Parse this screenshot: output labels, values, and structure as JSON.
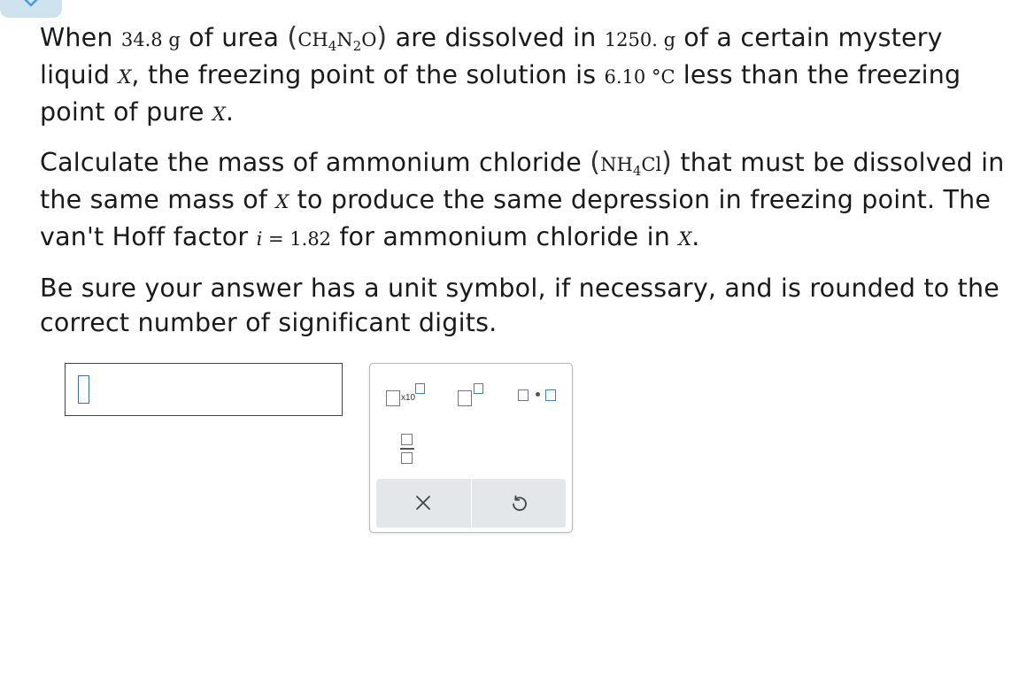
{
  "question": {
    "p1": {
      "t1": "When ",
      "urea_mass": "34.8",
      "urea_mass_unit": "g",
      "t2": " of urea ",
      "urea_formula": {
        "a": "CH",
        "s1": "4",
        "b": "N",
        "s2": "2",
        "c": "O"
      },
      "t3": " are dissolved in ",
      "liquid_mass": "1250.",
      "liquid_mass_unit": "g",
      "t4": " of a certain mystery liquid ",
      "liquid_symbol_1": "X",
      "t5": ", the freezing point of the solution is ",
      "dt_value": "6.10",
      "dt_unit": "°C",
      "t6": " less than the freezing point of pure ",
      "liquid_symbol_2": "X",
      "t7": "."
    },
    "p2": {
      "t1": "Calculate the mass of ammonium chloride ",
      "nh4cl_formula": {
        "a": "NH",
        "s1": "4",
        "b": "Cl"
      },
      "t2": " that must be dissolved in the same mass of ",
      "liquid_symbol_3": "X",
      "t3": " to produce the same depression in freezing point. The van't Hoff factor ",
      "i_symbol": "i",
      "i_equals": " = 1.82",
      "t4": " for ammonium chloride in ",
      "liquid_symbol_4": "X",
      "t5": "."
    },
    "p3": {
      "text": "Be sure your answer has a unit symbol, if necessary, and is rounded to the correct number of significant digits."
    }
  },
  "answer": {
    "value": ""
  },
  "palette": {
    "x10_label": "x10",
    "tools": [
      "scientific-notation",
      "superscript",
      "multiply-dot",
      "fraction"
    ],
    "actions": [
      "clear",
      "reset"
    ]
  },
  "colors": {
    "accent": "#3f82c0",
    "tab": "#cfe3ef",
    "action_bar": "#e3e7ea"
  }
}
